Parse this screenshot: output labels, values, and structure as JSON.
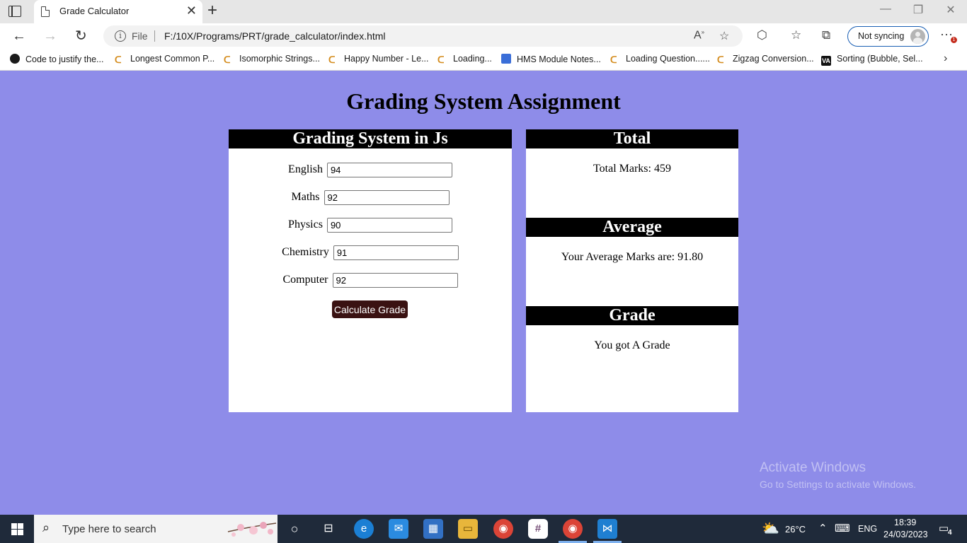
{
  "browser": {
    "tab_title": "Grade Calculator",
    "new_tab_symbol": "+",
    "scheme_label": "File",
    "url": "F:/10X/Programs/PRT/grade_calculator/index.html",
    "profile_label": "Not syncing",
    "notification_count": "1",
    "bookmarks": [
      {
        "label": "Code to justify the...",
        "icon": "github-icon"
      },
      {
        "label": "Longest Common P...",
        "icon": "leetcode-icon"
      },
      {
        "label": "Isomorphic Strings...",
        "icon": "leetcode-icon"
      },
      {
        "label": "Happy Number - Le...",
        "icon": "leetcode-icon"
      },
      {
        "label": "Loading...",
        "icon": "leetcode-icon"
      },
      {
        "label": "HMS Module Notes...",
        "icon": "document-icon"
      },
      {
        "label": "Loading Question......",
        "icon": "leetcode-icon"
      },
      {
        "label": "Zigzag Conversion...",
        "icon": "leetcode-icon"
      },
      {
        "label": "Sorting (Bubble, Sel...",
        "icon": "visualgo-icon"
      }
    ]
  },
  "page": {
    "heading": "Grading System Assignment",
    "form": {
      "title": "Grading System in Js",
      "fields": [
        {
          "label": "English",
          "value": "94"
        },
        {
          "label": "Maths",
          "value": "92"
        },
        {
          "label": "Physics",
          "value": "90"
        },
        {
          "label": "Chemistry",
          "value": "91"
        },
        {
          "label": "Computer",
          "value": "92"
        }
      ],
      "button_label": "Calculate Grade"
    },
    "results": {
      "total_title": "Total",
      "total_text": "Total Marks: 459",
      "average_title": "Average",
      "average_text": "Your Average Marks are: 91.80",
      "grade_title": "Grade",
      "grade_text": "You got A Grade"
    }
  },
  "watermark": {
    "line1": "Activate Windows",
    "line2": "Go to Settings to activate Windows."
  },
  "taskbar": {
    "search_placeholder": "Type here to search",
    "weather": "26°C",
    "language": "ENG",
    "time": "18:39",
    "date": "24/03/2023",
    "notifications": "4"
  },
  "colors": {
    "page_background": "#8e8ce9",
    "panel_header": "#000000",
    "button": "#3a1212"
  }
}
